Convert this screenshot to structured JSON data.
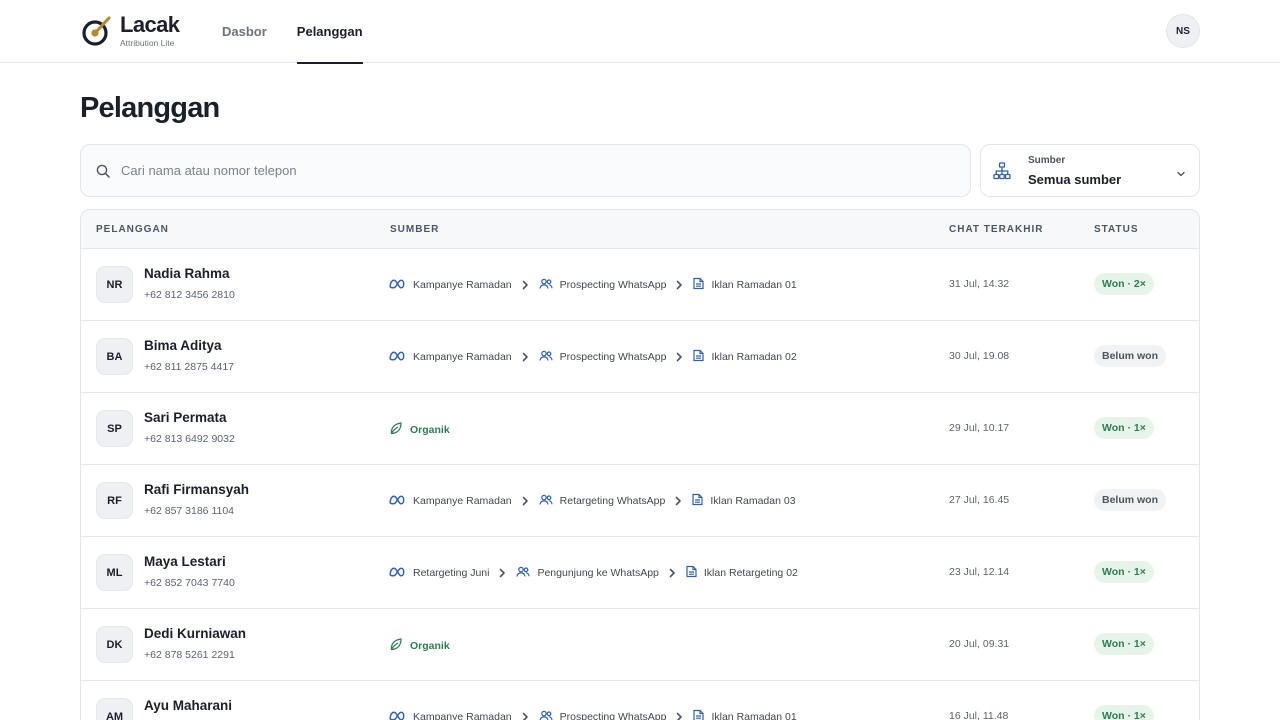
{
  "brand": {
    "name": "Lacak",
    "subtitle": "Attribution Lite"
  },
  "nav": {
    "tabs": [
      "Dasbor",
      "Pelanggan"
    ],
    "active": "Pelanggan"
  },
  "user": {
    "initials": "NS"
  },
  "page": {
    "title": "Pelanggan"
  },
  "search": {
    "placeholder": "Cari nama atau nomor telepon",
    "value": ""
  },
  "filter": {
    "label": "Sumber",
    "value": "Semua sumber"
  },
  "table": {
    "headers": {
      "customer": "PELANGGAN",
      "source": "SUMBER",
      "last_chat": "CHAT TERAKHIR",
      "status": "STATUS"
    },
    "rows": [
      {
        "initials": "NR",
        "name": "Nadia Rahma",
        "phone": "+62 812 3456 2810",
        "source_type": "meta",
        "campaign": "Kampanye Ramadan",
        "adset": "Prospecting WhatsApp",
        "ad": "Iklan Ramadan 01",
        "last_chat": "31 Jul, 14.32",
        "status": "Won · 2×",
        "status_type": "won"
      },
      {
        "initials": "BA",
        "name": "Bima Aditya",
        "phone": "+62 811 2875 4417",
        "source_type": "meta",
        "campaign": "Kampanye Ramadan",
        "adset": "Prospecting WhatsApp",
        "ad": "Iklan Ramadan 02",
        "last_chat": "30 Jul, 19.08",
        "status": "Belum won",
        "status_type": "pending"
      },
      {
        "initials": "SP",
        "name": "Sari Permata",
        "phone": "+62 813 6492 9032",
        "source_type": "organic",
        "organic_label": "Organik",
        "last_chat": "29 Jul, 10.17",
        "status": "Won · 1×",
        "status_type": "won"
      },
      {
        "initials": "RF",
        "name": "Rafi Firmansyah",
        "phone": "+62 857 3186 1104",
        "source_type": "meta",
        "campaign": "Kampanye Ramadan",
        "adset": "Retargeting WhatsApp",
        "ad": "Iklan Ramadan 03",
        "last_chat": "27 Jul, 16.45",
        "status": "Belum won",
        "status_type": "pending"
      },
      {
        "initials": "ML",
        "name": "Maya Lestari",
        "phone": "+62 852 7043 7740",
        "source_type": "meta",
        "campaign": "Retargeting Juni",
        "adset": "Pengunjung ke WhatsApp",
        "ad": "Iklan Retargeting 02",
        "last_chat": "23 Jul, 12.14",
        "status": "Won · 1×",
        "status_type": "won"
      },
      {
        "initials": "DK",
        "name": "Dedi Kurniawan",
        "phone": "+62 878 5261 2291",
        "source_type": "organic",
        "organic_label": "Organik",
        "last_chat": "20 Jul, 09.31",
        "status": "Won · 1×",
        "status_type": "won"
      },
      {
        "initials": "AM",
        "name": "Ayu Maharani",
        "phone": "",
        "source_type": "meta",
        "campaign": "Kampanye Ramadan",
        "adset": "Prospecting WhatsApp",
        "ad": "Iklan Ramadan 01",
        "last_chat": "16 Jul, 11.48",
        "status": "Won · 1×",
        "status_type": "won"
      }
    ]
  },
  "colors": {
    "accent": "#1a1f2b",
    "won_bg": "#e6f4ea",
    "won_text": "#2e7d4f",
    "meta_blue": "#2f5fb3",
    "logo_gold": "#b8892a"
  },
  "icons": {
    "meta": "meta-icon",
    "adset": "users-icon",
    "ad": "document-icon",
    "organic": "leaf-icon",
    "chevron": "chevron-right-icon"
  }
}
